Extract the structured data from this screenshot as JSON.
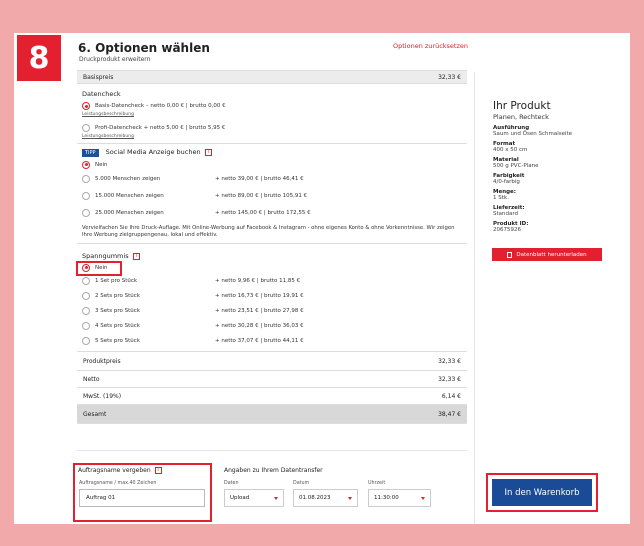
{
  "step": "8",
  "header": {
    "title": "6. Optionen wählen",
    "subtitle": "Druckprodukt erweitern",
    "reset_link": "Optionen zurücksetzen"
  },
  "basispreis": {
    "label": "Basispreis",
    "value": "32,33 €"
  },
  "datencheck": {
    "title": "Datencheck",
    "options": [
      {
        "label": "Basis-Datencheck – netto 0,00 € | brutto 0,00 €",
        "selected": true,
        "desc": "Leistungsbeschreibung"
      },
      {
        "label": "Profi-Datencheck + netto 5,00 € | brutto 5,95 €",
        "selected": false,
        "desc": "Leistungsbeschreibung"
      }
    ]
  },
  "social": {
    "tipp": "TIPP",
    "title": "Social Media Anzeige buchen",
    "options": [
      {
        "label": "Nein",
        "price": "",
        "selected": true
      },
      {
        "label": "5.000 Menschen zeigen",
        "price": "+ netto 39,00 € | brutto 46,41 €",
        "selected": false
      },
      {
        "label": "15.000 Menschen zeigen",
        "price": "+ netto 89,00 € | brutto 105,91 €",
        "selected": false
      },
      {
        "label": "25.000 Menschen zeigen",
        "price": "+ netto 145,00 € | brutto 172,55 €",
        "selected": false
      }
    ],
    "promo": "Vervielfachen Sie Ihre Druck-Auflage. Mit Online-Werbung auf Facebook & Instagram - ohne eigenes Konto & ohne Vorkenntnisse. Wir zeigen Ihre Werbung zielgruppengenau, lokal und effektiv."
  },
  "spanngummis": {
    "title": "Spanngummis",
    "options": [
      {
        "label": "Nein",
        "price": "",
        "selected": true
      },
      {
        "label": "1 Set pro Stück",
        "price": "+ netto 9,96 € | brutto 11,85 €",
        "selected": false
      },
      {
        "label": "2 Sets pro Stück",
        "price": "+ netto 16,73 € | brutto 19,91 €",
        "selected": false
      },
      {
        "label": "3 Sets pro Stück",
        "price": "+ netto 23,51 € | brutto 27,98 €",
        "selected": false
      },
      {
        "label": "4 Sets pro Stück",
        "price": "+ netto 30,28 € | brutto 36,03 €",
        "selected": false
      },
      {
        "label": "5 Sets pro Stück",
        "price": "+ netto 37,07 € | brutto 44,11 €",
        "selected": false
      }
    ]
  },
  "summary": [
    {
      "label": "Produktpreis",
      "value": "32,33 €"
    },
    {
      "label": "Netto",
      "value": "32,33 €"
    },
    {
      "label": "MwSt. (19%)",
      "value": "6,14 €"
    },
    {
      "label": "Gesamt",
      "value": "38,47 €"
    }
  ],
  "side": {
    "title": "Ihr Produkt",
    "subtitle": "Planen, Rechteck",
    "specs": [
      {
        "key": "Ausführung",
        "value": "Saum und Ösen Schmalseite"
      },
      {
        "key": "Format",
        "value": "400 x 50 cm"
      },
      {
        "key": "Material",
        "value": "500 g PVC-Plane"
      },
      {
        "key": "Farbigkeit",
        "value": "4/0-farbig"
      },
      {
        "key": "Menge:",
        "value": "1 Stk."
      },
      {
        "key": "Lieferzeit:",
        "value": "Standard"
      },
      {
        "key": "Produkt ID:",
        "value": "20675926"
      }
    ],
    "download": "Datenblatt herunterladen"
  },
  "order": {
    "title": "Auftragsname vergeben",
    "field_label": "Auftragsname / max.40 Zeichen",
    "field_value": "Auftrag 01"
  },
  "transfer": {
    "title": "Angaben zu Ihrem Datentransfer",
    "daten_label": "Daten",
    "daten_value": "Upload",
    "datum_label": "Datum",
    "datum_value": "01.08.2023",
    "uhrzeit_label": "Uhrzeit",
    "uhrzeit_value": "11:30:00"
  },
  "cart_button": "In den Warenkorb",
  "colors": {
    "accent": "#e2202f",
    "primary": "#1a4b97",
    "background": "#f1a9aa"
  }
}
